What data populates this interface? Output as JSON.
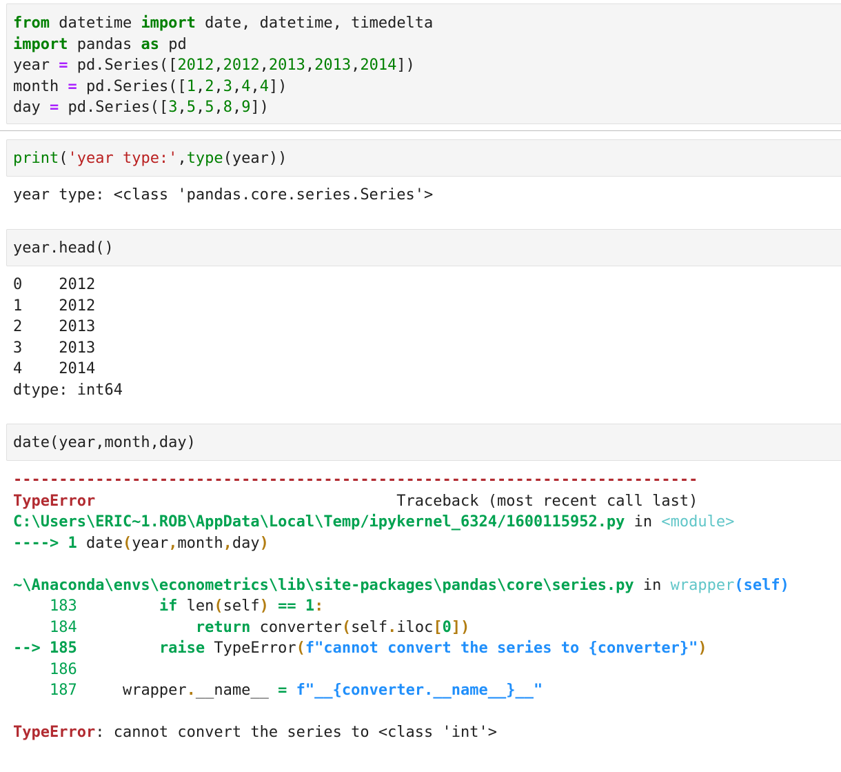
{
  "cells": [
    {
      "input_lines": [
        [
          [
            "kw",
            "from"
          ],
          [
            "plain",
            " datetime "
          ],
          [
            "kw",
            "import"
          ],
          [
            "plain",
            " date, datetime, timedelta"
          ]
        ],
        [
          [
            "kw",
            "import"
          ],
          [
            "plain",
            " pandas "
          ],
          [
            "kw",
            "as"
          ],
          [
            "plain",
            " pd"
          ]
        ],
        [
          [
            "plain",
            "year "
          ],
          [
            "op",
            "="
          ],
          [
            "plain",
            " pd.Series(["
          ],
          [
            "num",
            "2012"
          ],
          [
            "plain",
            ","
          ],
          [
            "num",
            "2012"
          ],
          [
            "plain",
            ","
          ],
          [
            "num",
            "2013"
          ],
          [
            "plain",
            ","
          ],
          [
            "num",
            "2013"
          ],
          [
            "plain",
            ","
          ],
          [
            "num",
            "2014"
          ],
          [
            "plain",
            "])"
          ]
        ],
        [
          [
            "plain",
            "month "
          ],
          [
            "op",
            "="
          ],
          [
            "plain",
            " pd.Series(["
          ],
          [
            "num",
            "1"
          ],
          [
            "plain",
            ","
          ],
          [
            "num",
            "2"
          ],
          [
            "plain",
            ","
          ],
          [
            "num",
            "3"
          ],
          [
            "plain",
            ","
          ],
          [
            "num",
            "4"
          ],
          [
            "plain",
            ","
          ],
          [
            "num",
            "4"
          ],
          [
            "plain",
            "])"
          ]
        ],
        [
          [
            "plain",
            "day "
          ],
          [
            "op",
            "="
          ],
          [
            "plain",
            " pd.Series(["
          ],
          [
            "num",
            "3"
          ],
          [
            "plain",
            ","
          ],
          [
            "num",
            "5"
          ],
          [
            "plain",
            ","
          ],
          [
            "num",
            "5"
          ],
          [
            "plain",
            ","
          ],
          [
            "num",
            "8"
          ],
          [
            "plain",
            ","
          ],
          [
            "num",
            "9"
          ],
          [
            "plain",
            "])"
          ]
        ]
      ]
    },
    {
      "input_lines": [
        [
          [
            "bi",
            "print"
          ],
          [
            "plain",
            "("
          ],
          [
            "str",
            "'year type:'"
          ],
          [
            "plain",
            ","
          ],
          [
            "bi",
            "type"
          ],
          [
            "plain",
            "(year))"
          ]
        ]
      ],
      "output_lines": [
        [
          [
            "plain",
            "year type: <class 'pandas.core.series.Series'>"
          ]
        ]
      ]
    },
    {
      "input_lines": [
        [
          [
            "plain",
            "year.head()"
          ]
        ]
      ],
      "output_lines": [
        [
          [
            "plain",
            "0    2012"
          ]
        ],
        [
          [
            "plain",
            "1    2012"
          ]
        ],
        [
          [
            "plain",
            "2    2013"
          ]
        ],
        [
          [
            "plain",
            "3    2013"
          ]
        ],
        [
          [
            "plain",
            "4    2014"
          ]
        ],
        [
          [
            "plain",
            "dtype: int64"
          ]
        ]
      ]
    },
    {
      "input_lines": [
        [
          [
            "plain",
            "date(year,month,day)"
          ]
        ]
      ],
      "output_lines": [
        [
          [
            "tb-dash",
            "---------------------------------------------------------------------------"
          ]
        ],
        [
          [
            "tb-red",
            "TypeError"
          ],
          [
            "plain",
            "                                 Traceback (most recent call last)"
          ]
        ],
        [
          [
            "tb-green",
            "C:\\Users\\ERIC~1.ROB\\AppData\\Local\\Temp/ipykernel_6324/1600115952.py"
          ],
          [
            "plain",
            " in "
          ],
          [
            "tb-cyan",
            "<module>"
          ]
        ],
        [
          [
            "tb-green",
            "----> 1 "
          ],
          [
            "plain",
            "date"
          ],
          [
            "tb-yellow",
            "("
          ],
          [
            "plain",
            "year"
          ],
          [
            "tb-yellow",
            ","
          ],
          [
            "plain",
            "month"
          ],
          [
            "tb-yellow",
            ","
          ],
          [
            "plain",
            "day"
          ],
          [
            "tb-yellow",
            ")"
          ]
        ],
        [
          [
            "plain",
            ""
          ]
        ],
        [
          [
            "tb-green",
            "~\\Anaconda\\envs\\econometrics\\lib\\site-packages\\pandas\\core\\series.py"
          ],
          [
            "plain",
            " in "
          ],
          [
            "tb-cyan",
            "wrapper"
          ],
          [
            "tb-blue",
            "(self)"
          ]
        ],
        [
          [
            "tb-ngreen",
            "    183 "
          ],
          [
            "plain",
            "        "
          ],
          [
            "tb-green",
            "if"
          ],
          [
            "plain",
            " len"
          ],
          [
            "tb-yellow",
            "("
          ],
          [
            "plain",
            "self"
          ],
          [
            "tb-yellow",
            ")"
          ],
          [
            "plain",
            " "
          ],
          [
            "tb-green",
            "=="
          ],
          [
            "plain",
            " "
          ],
          [
            "tb-green",
            "1"
          ],
          [
            "tb-yellow",
            ":"
          ]
        ],
        [
          [
            "tb-ngreen",
            "    184 "
          ],
          [
            "plain",
            "            "
          ],
          [
            "tb-green",
            "return"
          ],
          [
            "plain",
            " converter"
          ],
          [
            "tb-yellow",
            "("
          ],
          [
            "plain",
            "self"
          ],
          [
            "tb-yellow",
            "."
          ],
          [
            "plain",
            "iloc"
          ],
          [
            "tb-yellow",
            "["
          ],
          [
            "tb-green",
            "0"
          ],
          [
            "tb-yellow",
            "])"
          ]
        ],
        [
          [
            "tb-green",
            "--> 185 "
          ],
          [
            "plain",
            "        "
          ],
          [
            "tb-green",
            "raise"
          ],
          [
            "plain",
            " TypeError"
          ],
          [
            "tb-yellow",
            "("
          ],
          [
            "tb-blue",
            "f\"cannot convert the series to {converter}\""
          ],
          [
            "tb-yellow",
            ")"
          ]
        ],
        [
          [
            "tb-ngreen",
            "    186 "
          ]
        ],
        [
          [
            "tb-ngreen",
            "    187 "
          ],
          [
            "plain",
            "    wrapper"
          ],
          [
            "tb-yellow",
            "."
          ],
          [
            "plain",
            "__name__ "
          ],
          [
            "tb-green",
            "="
          ],
          [
            "plain",
            " "
          ],
          [
            "tb-blue",
            "f\"__{converter.__name__}__\""
          ]
        ],
        [
          [
            "plain",
            ""
          ]
        ],
        [
          [
            "tb-red",
            "TypeError"
          ],
          [
            "plain",
            ": cannot convert the series to <class 'int'>"
          ]
        ]
      ]
    }
  ]
}
